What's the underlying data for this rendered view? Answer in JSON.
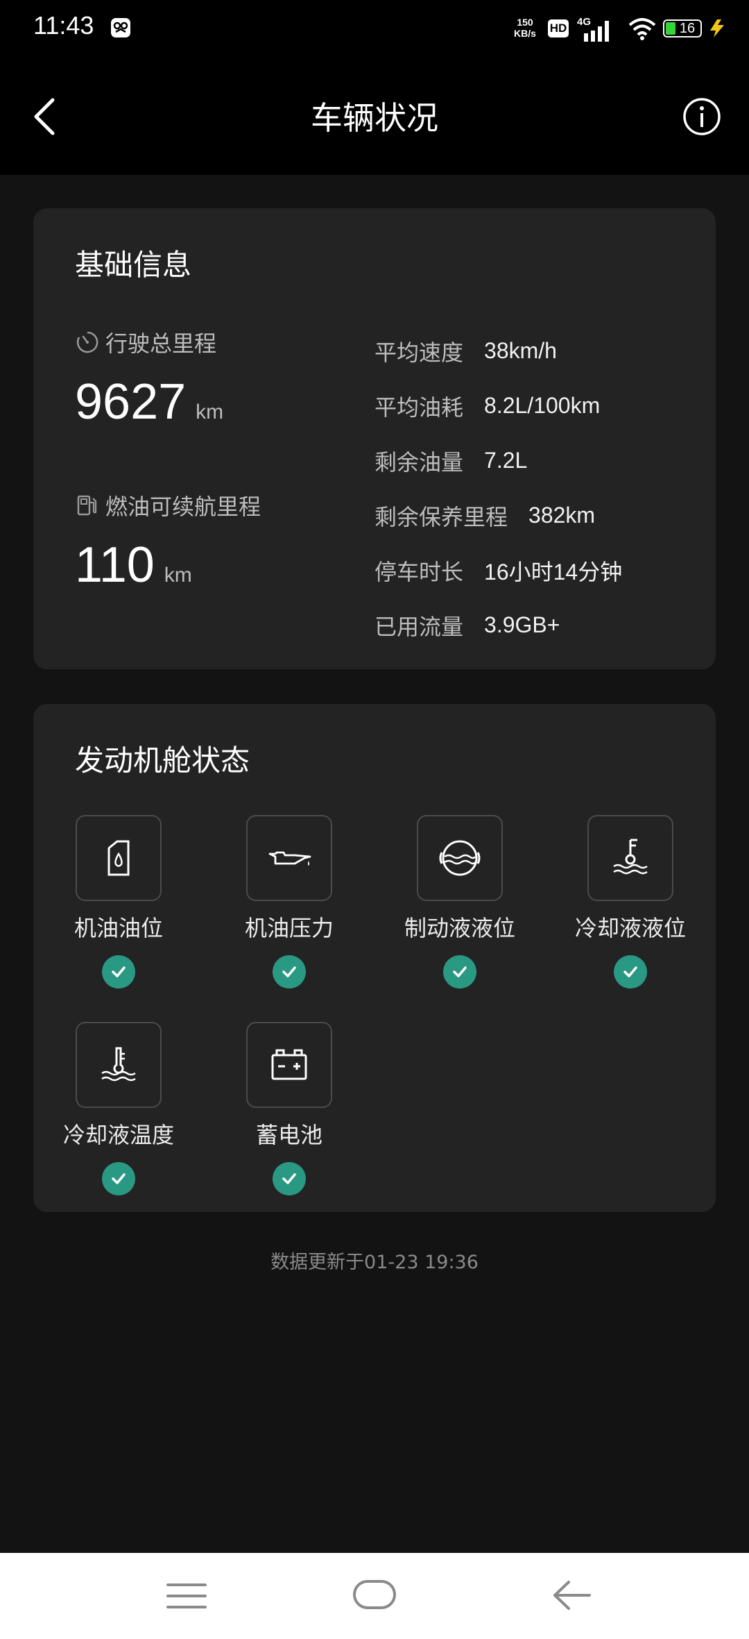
{
  "status_bar": {
    "time": "11:43",
    "net_speed_value": "150",
    "net_speed_unit": "KB/s",
    "hd": "HD",
    "network": "4G",
    "battery": "16",
    "icons": [
      "app-notification-icon",
      "signal-icon",
      "wifi-icon",
      "battery-icon",
      "charging-icon"
    ]
  },
  "header": {
    "title": "车辆状况",
    "back_icon": "chevron-left-icon",
    "info_icon": "info-icon"
  },
  "basic_info": {
    "title": "基础信息",
    "total_mileage": {
      "label": "行驶总里程",
      "value": "9627",
      "unit": "km",
      "icon": "speedometer-icon"
    },
    "fuel_range": {
      "label": "燃油可续航里程",
      "value": "110",
      "unit": "km",
      "icon": "fuel-pump-icon"
    },
    "details": [
      {
        "label": "平均速度",
        "value": "38km/h"
      },
      {
        "label": "平均油耗",
        "value": "8.2L/100km"
      },
      {
        "label": "剩余油量",
        "value": "7.2L"
      },
      {
        "label": "剩余保养里程",
        "value": "382km"
      },
      {
        "label": "停车时长",
        "value": "16小时14分钟"
      },
      {
        "label": "已用流量",
        "value": "3.9GB+"
      }
    ]
  },
  "engine": {
    "title": "发动机舱状态",
    "items": [
      {
        "label": "机油油位",
        "icon": "oil-level-icon",
        "status": "ok"
      },
      {
        "label": "机油压力",
        "icon": "oil-pressure-icon",
        "status": "ok"
      },
      {
        "label": "制动液液位",
        "icon": "brake-fluid-icon",
        "status": "ok"
      },
      {
        "label": "冷却液液位",
        "icon": "coolant-level-icon",
        "status": "ok"
      },
      {
        "label": "冷却液温度",
        "icon": "coolant-temperature-icon",
        "status": "ok"
      },
      {
        "label": "蓄电池",
        "icon": "battery-icon",
        "status": "ok"
      }
    ]
  },
  "footer": {
    "update_text": "数据更新于01-23 19:36"
  },
  "colors": {
    "background": "#131313",
    "card": "#232323",
    "check": "#2a9983",
    "battery_fill": "#36d33a"
  }
}
